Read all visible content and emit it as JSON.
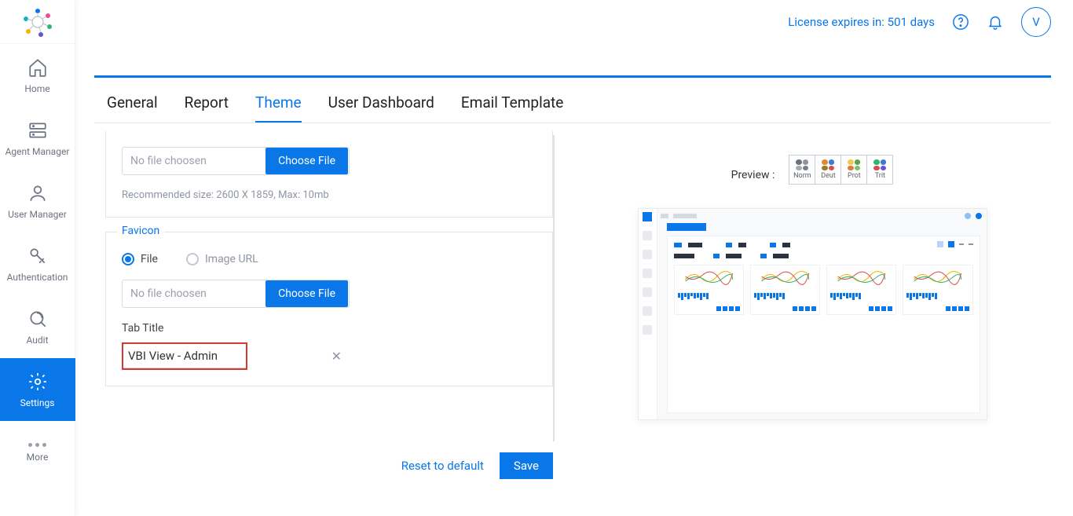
{
  "header": {
    "license_text": "License expires in: 501 days",
    "avatar_initial": "V"
  },
  "sidebar": {
    "items": [
      {
        "label": "Home"
      },
      {
        "label": "Agent Manager"
      },
      {
        "label": "User Manager"
      },
      {
        "label": "Authentication"
      },
      {
        "label": "Audit"
      },
      {
        "label": "Settings"
      },
      {
        "label": "More"
      }
    ]
  },
  "tabs": [
    {
      "label": "General"
    },
    {
      "label": "Report"
    },
    {
      "label": "Theme"
    },
    {
      "label": "User Dashboard"
    },
    {
      "label": "Email Template"
    }
  ],
  "upload1": {
    "placeholder": "No file choosen",
    "button": "Choose File",
    "hint": "Recommended size: 2600 X 1859, Max: 10mb"
  },
  "favicon": {
    "title": "Favicon",
    "radio_file": "File",
    "radio_url": "Image URL",
    "placeholder": "No file choosen",
    "button": "Choose File",
    "tab_title_label": "Tab Title",
    "tab_title_value": "VBI View - Admin"
  },
  "preview": {
    "label": "Preview :",
    "modes": [
      "Norm",
      "Deut",
      "Prot",
      "Trit"
    ]
  },
  "actions": {
    "reset": "Reset to default",
    "save": "Save"
  }
}
